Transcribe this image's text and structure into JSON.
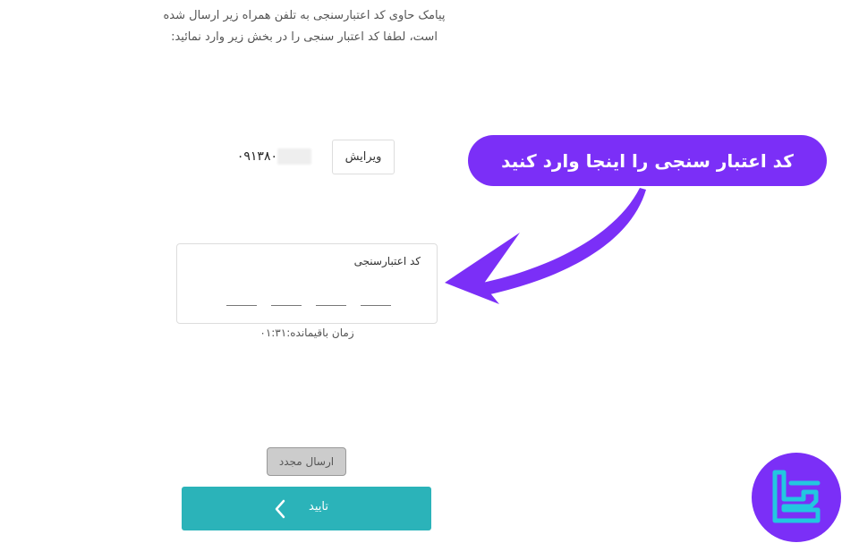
{
  "instruction": {
    "line1": "پیامک حاوی کد اعتبارسنجی به تلفن همراه زیر ارسال شده",
    "line2": "است، لطفا کد اعتبار سنجی را در بخش زیر وارد نمائید:"
  },
  "phone": {
    "visible_prefix": "۰۹۱۳۸۰",
    "edit_label": "ویرایش"
  },
  "otp": {
    "label": "کد اعتبارسنجی",
    "digits": [
      "",
      "",
      "",
      ""
    ]
  },
  "timer": {
    "label": "زمان باقیمانده:",
    "value": "۰۱:۳۱"
  },
  "buttons": {
    "resend_label": "ارسال مجدد",
    "confirm_label": "تایید"
  },
  "callout": {
    "text": "کد اعتبار سنجی را اینجا وارد کنید"
  },
  "icons": {
    "confirm": "chevron-left-icon",
    "callout_pointer": "curved-arrow-icon",
    "brand": "tradingfinder-logo-icon"
  },
  "colors": {
    "accent_teal": "#2bb3b9",
    "callout_purple": "#7b2ff7",
    "logo_cyan": "#22c7e0",
    "disabled_gray": "#cccccc"
  }
}
